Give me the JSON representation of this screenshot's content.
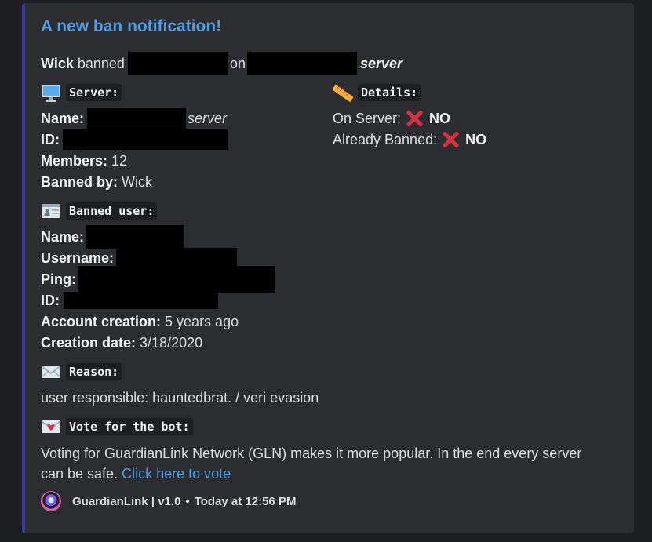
{
  "embed": {
    "title": "A new ban notification!",
    "header_line": {
      "actor": "Wick",
      "verb": "banned",
      "prep": "on",
      "server_word": "server"
    },
    "server_section": {
      "heading": "Server:",
      "name_label": "Name:",
      "name_suffix": "server",
      "id_label": "ID:",
      "members_label": "Members:",
      "members_value": "12",
      "banned_by_label": "Banned by:",
      "banned_by_value": "Wick"
    },
    "details_section": {
      "heading": "Details:",
      "on_server_label": "On Server:",
      "on_server_value": "NO",
      "already_banned_label": "Already Banned:",
      "already_banned_value": "NO"
    },
    "banned_user_section": {
      "heading": "Banned user:",
      "name_label": "Name:",
      "username_label": "Username:",
      "ping_label": "Ping:",
      "id_label": "ID:",
      "account_creation_label": "Account creation:",
      "account_creation_value": "5 years ago",
      "creation_date_label": "Creation date:",
      "creation_date_value": "3/18/2020"
    },
    "reason_section": {
      "heading": "Reason:",
      "text": "user responsible: hauntedbrat. / veri evasion"
    },
    "vote_section": {
      "heading": "Vote for the bot:",
      "text": "Voting for GuardianLink Network (GLN) makes it more popular. In the end every server can be safe.",
      "link_text": "Click here to vote"
    },
    "footer": {
      "text": "GuardianLink | v1.0",
      "separator": "•",
      "timestamp": "Today at 12:56 PM"
    }
  },
  "colors": {
    "background": "#1e1f22",
    "embed_bg": "#2b2d31",
    "embed_border": "#3b39a6",
    "title": "#4e9de6",
    "link": "#4e9de6",
    "x_mark": "#dd2e44"
  },
  "icons": {
    "server": "desktop-computer-icon",
    "details": "ruler-icon",
    "banned_user": "id-card-icon",
    "reason": "envelope-icon",
    "vote": "love-letter-icon",
    "status": "cross-mark-icon"
  }
}
